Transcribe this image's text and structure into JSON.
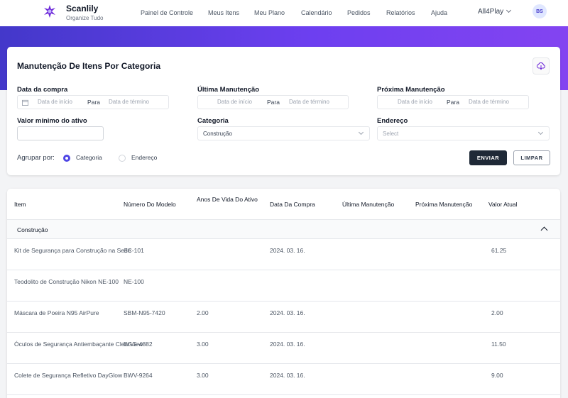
{
  "app": {
    "name": "Scanlily",
    "tagline": "Organize Tudo"
  },
  "nav": [
    "Painel de Controle",
    "Meus Itens",
    "Meu Plano",
    "Calendário",
    "Pedidos",
    "Relatórios",
    "Ajuda"
  ],
  "workspace": "All4Play",
  "user_initials": "BS",
  "colors": {
    "accent": "#4f46e5",
    "banner_start": "#4338ca",
    "banner_end": "#8344f1",
    "primary_button": "#1f2937"
  },
  "report": {
    "title": "Manutenção De Itens Por Categoria",
    "download_icon": "cloud-download-icon",
    "purchase_date": {
      "label": "Data da compra",
      "start_placeholder": "Data de início",
      "separator": "Para",
      "end_placeholder": "Data de término"
    },
    "last_maintenance": {
      "label": "Última Manutenção",
      "start_placeholder": "Data de início",
      "separator": "Para",
      "end_placeholder": "Data de término"
    },
    "next_maintenance": {
      "label": "Próxima Manutenção",
      "start_placeholder": "Data de início",
      "separator": "Para",
      "end_placeholder": "Data de término"
    },
    "min_value": {
      "label": "Valor mínimo do ativo",
      "value": ""
    },
    "category": {
      "label": "Categoria",
      "value": "Construção"
    },
    "address": {
      "label": "Endereço",
      "placeholder": "Select"
    },
    "group_by": {
      "label": "Agrupar por:",
      "options": [
        "Categoria",
        "Endereço"
      ],
      "selected": "Categoria"
    },
    "send_label": "ENVIAR",
    "clear_label": "LIMPAR"
  },
  "table": {
    "headers": [
      "Item",
      "Número Do Modelo",
      "Anos De Vida Do Ativo",
      "Data Da Compra",
      "Última Manutenção",
      "Próxima Manutenção",
      "Valor Atual"
    ],
    "group": "Construção",
    "rows": [
      {
        "item": "Kit de Segurança para Construção na Sede",
        "model": "SC-101",
        "life": "",
        "purchase": "2024. 03. 16.",
        "last": "",
        "next": "",
        "value": "61.25"
      },
      {
        "item": "Teodolito de Construção Nikon NE-100",
        "model": "NE-100",
        "life": "",
        "purchase": "",
        "last": "",
        "next": "",
        "value": ""
      },
      {
        "item": "Máscara de Poeira N95 AirPure",
        "model": "SBM-N95-7420",
        "life": "2.00",
        "purchase": "2024. 03. 16.",
        "last": "",
        "next": "",
        "value": "2.00"
      },
      {
        "item": "Óculos de Segurança Antiembaçante ClearView",
        "model": "EGG-4882",
        "life": "3.00",
        "purchase": "2024. 03. 16.",
        "last": "",
        "next": "",
        "value": "11.50"
      },
      {
        "item": "Colete de Segurança Refletivo DayGlow",
        "model": "BWV-9264",
        "life": "3.00",
        "purchase": "2024. 03. 16.",
        "last": "",
        "next": "",
        "value": "9.00"
      }
    ]
  }
}
